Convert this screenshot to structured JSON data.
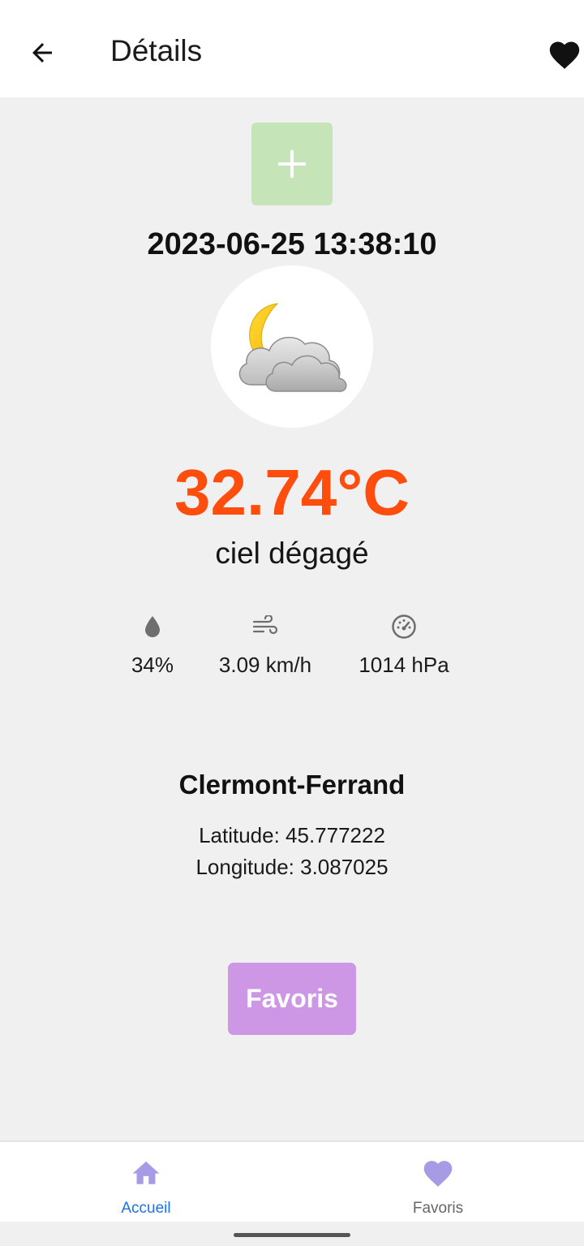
{
  "appbar": {
    "back_icon": "arrow-left-icon",
    "title": "Détails",
    "favorite_icon": "heart-filled-icon"
  },
  "add_button": {
    "icon": "plus-icon",
    "color": "#c5e4b8"
  },
  "weather": {
    "datetime": "2023-06-25 13:38:10",
    "icon": "moon-cloud-icon",
    "temperature": "32.74°C",
    "temperature_color": "#ff4d0d",
    "description": "ciel dégagé"
  },
  "stats": {
    "humidity": {
      "icon": "water-drop-icon",
      "value": "34%"
    },
    "wind": {
      "icon": "wind-icon",
      "value": "3.09 km/h"
    },
    "pressure": {
      "icon": "gauge-icon",
      "value": "1014 hPa"
    }
  },
  "location": {
    "city": "Clermont-Ferrand",
    "latitude": "Latitude: 45.777222",
    "longitude": "Longitude: 3.087025"
  },
  "favoris_button": {
    "label": "Favoris",
    "color": "#cd97e6"
  },
  "bottom_nav": {
    "items": [
      {
        "label": "Accueil",
        "icon": "home-icon",
        "active": true,
        "color": "#1a73e8"
      },
      {
        "label": "Favoris",
        "icon": "heart-icon",
        "active": false,
        "color": "#666666"
      }
    ],
    "icon_color": "#a79be6"
  }
}
